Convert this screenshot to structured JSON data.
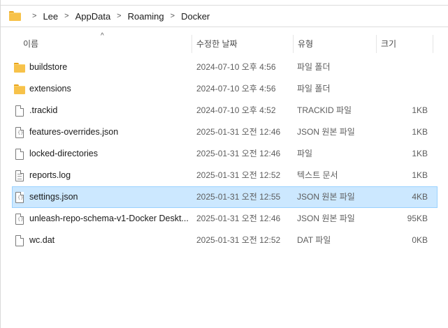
{
  "breadcrumb": {
    "items": [
      "Lee",
      "AppData",
      "Roaming",
      "Docker"
    ]
  },
  "columns": {
    "name": "이름",
    "date": "수정한 날짜",
    "type": "유형",
    "size": "크기"
  },
  "files": [
    {
      "name": "buildstore",
      "date": "2024-07-10 오후 4:56",
      "type": "파일 폴더",
      "size": "",
      "icon": "folder-icon"
    },
    {
      "name": "extensions",
      "date": "2024-07-10 오후 4:56",
      "type": "파일 폴더",
      "size": "",
      "icon": "folder-icon"
    },
    {
      "name": ".trackid",
      "date": "2024-07-10 오후 4:52",
      "type": "TRACKID 파일",
      "size": "1KB",
      "icon": "file-icon"
    },
    {
      "name": "features-overrides.json",
      "date": "2025-01-31 오전 12:46",
      "type": "JSON 원본 파일",
      "size": "1KB",
      "icon": "json-file-icon"
    },
    {
      "name": "locked-directories",
      "date": "2025-01-31 오전 12:46",
      "type": "파일",
      "size": "1KB",
      "icon": "file-icon"
    },
    {
      "name": "reports.log",
      "date": "2025-01-31 오전 12:52",
      "type": "텍스트 문서",
      "size": "1KB",
      "icon": "text-file-icon"
    },
    {
      "name": "settings.json",
      "date": "2025-01-31 오전 12:55",
      "type": "JSON 원본 파일",
      "size": "4KB",
      "icon": "json-file-icon"
    },
    {
      "name": "unleash-repo-schema-v1-Docker Deskt...",
      "date": "2025-01-31 오전 12:46",
      "type": "JSON 원본 파일",
      "size": "95KB",
      "icon": "json-file-icon"
    },
    {
      "name": "wc.dat",
      "date": "2025-01-31 오전 12:52",
      "type": "DAT 파일",
      "size": "0KB",
      "icon": "file-icon"
    }
  ],
  "selected_file": "settings.json",
  "colors": {
    "selection_bg": "#cce8ff",
    "selection_border": "#99d1ff",
    "folder": "#f7c24a"
  }
}
